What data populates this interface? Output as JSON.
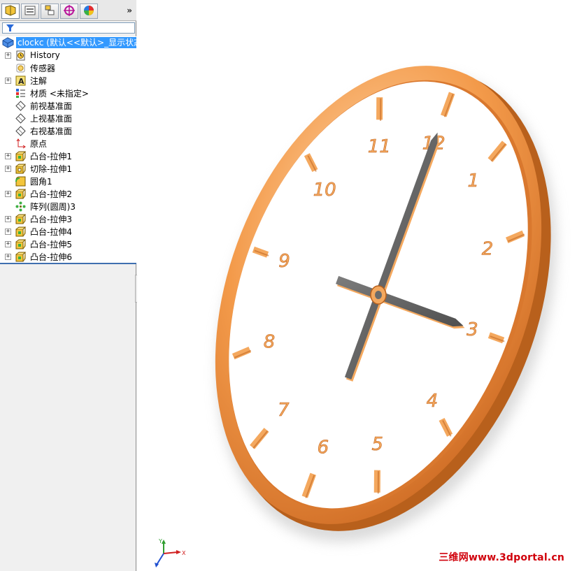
{
  "tabs": [
    {
      "name": "feature-manager-tab",
      "icon": "feature-tree-icon"
    },
    {
      "name": "property-manager-tab",
      "icon": "property-manager-icon"
    },
    {
      "name": "configuration-manager-tab",
      "icon": "configuration-icon"
    },
    {
      "name": "dimxpert-manager-tab",
      "icon": "dimxpert-icon"
    },
    {
      "name": "display-manager-tab",
      "icon": "display-manager-icon"
    }
  ],
  "expand_label": "»",
  "tree": {
    "root": {
      "label": "clockc",
      "suffix": "(默认<<默认>_显示状态"
    },
    "items": [
      {
        "label": "History",
        "icon": "history-icon",
        "expandable": true
      },
      {
        "label": "传感器",
        "icon": "sensor-icon",
        "expandable": false
      },
      {
        "label": "注解",
        "icon": "annotation-icon",
        "expandable": true
      },
      {
        "label": "材质 <未指定>",
        "icon": "material-icon",
        "expandable": false
      },
      {
        "label": "前视基准面",
        "icon": "plane-icon",
        "expandable": false
      },
      {
        "label": "上视基准面",
        "icon": "plane-icon",
        "expandable": false
      },
      {
        "label": "右视基准面",
        "icon": "plane-icon",
        "expandable": false
      },
      {
        "label": "原点",
        "icon": "origin-icon",
        "expandable": false
      },
      {
        "label": "凸台-拉伸1",
        "icon": "extrude-boss-icon",
        "expandable": true
      },
      {
        "label": "切除-拉伸1",
        "icon": "extrude-cut-icon",
        "expandable": true
      },
      {
        "label": "圆角1",
        "icon": "fillet-icon",
        "expandable": false
      },
      {
        "label": "凸台-拉伸2",
        "icon": "extrude-boss-icon",
        "expandable": true
      },
      {
        "label": "阵列(圆周)3",
        "icon": "circular-pattern-icon",
        "expandable": false
      },
      {
        "label": "凸台-拉伸3",
        "icon": "extrude-boss-icon",
        "expandable": true
      },
      {
        "label": "凸台-拉伸4",
        "icon": "extrude-boss-icon",
        "expandable": true
      },
      {
        "label": "凸台-拉伸5",
        "icon": "extrude-boss-icon",
        "expandable": true
      },
      {
        "label": "凸台-拉伸6",
        "icon": "extrude-boss-icon",
        "expandable": true
      }
    ]
  },
  "clock": {
    "numerals": [
      "1",
      "2",
      "3",
      "4",
      "5",
      "6",
      "7",
      "8",
      "9",
      "10",
      "11",
      "12"
    ]
  },
  "triad": {
    "x": "X",
    "y": "Y"
  },
  "watermark": "三维网www.3dportal.cn",
  "colors": {
    "selection": "#3399ff",
    "clock_rim": "#e8873a",
    "clock_accent": "#f4a85e",
    "hands": "#6b6b6b",
    "watermark": "#d0000b"
  }
}
